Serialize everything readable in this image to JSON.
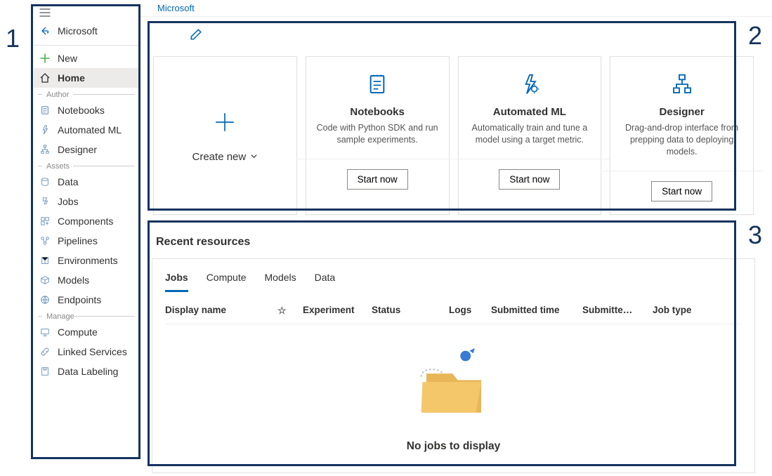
{
  "breadcrumb": "Microsoft",
  "sidebar": {
    "back_label": "Microsoft",
    "new": "New",
    "home": "Home",
    "section_author": "Author",
    "notebooks": "Notebooks",
    "automated_ml": "Automated ML",
    "designer": "Designer",
    "section_assets": "Assets",
    "data": "Data",
    "jobs": "Jobs",
    "components": "Components",
    "pipelines": "Pipelines",
    "environments": "Environments",
    "models": "Models",
    "endpoints": "Endpoints",
    "section_manage": "Manage",
    "compute": "Compute",
    "linked_services": "Linked Services",
    "data_labeling": "Data Labeling"
  },
  "cards": {
    "create_new": "Create new",
    "notebooks": {
      "title": "Notebooks",
      "desc": "Code with Python SDK and run sample experiments.",
      "button": "Start now"
    },
    "automl": {
      "title": "Automated ML",
      "desc": "Automatically train and tune a model using a target metric.",
      "button": "Start now"
    },
    "designer": {
      "title": "Designer",
      "desc": "Drag-and-drop interface from prepping data to deploying models.",
      "button": "Start now"
    }
  },
  "recent": {
    "heading": "Recent resources",
    "tabs": {
      "jobs": "Jobs",
      "compute": "Compute",
      "models": "Models",
      "data": "Data"
    },
    "columns": {
      "display_name": "Display name",
      "experiment": "Experiment",
      "status": "Status",
      "logs": "Logs",
      "submitted_time": "Submitted time",
      "submitted_by": "Submitte…",
      "job_type": "Job type"
    },
    "empty": "No jobs to display"
  },
  "annotations": {
    "a1": "1",
    "a2": "2",
    "a3": "3"
  }
}
